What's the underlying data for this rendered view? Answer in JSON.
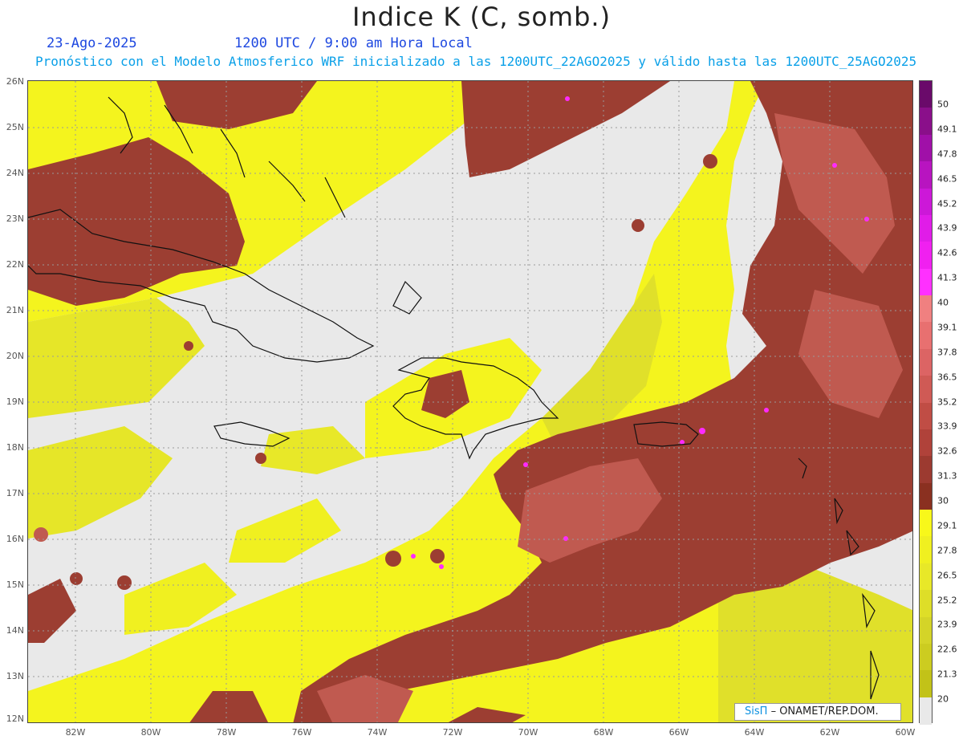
{
  "title": "Indice K (C, somb.)",
  "date": "23-Ago-2025",
  "valid_time": "1200 UTC / 9:00 am Hora Local",
  "subtitle": "Pronóstico con el Modelo Atmosferico WRF inicializado a las 1200UTC_22AGO2025 y válido hasta las  1200UTC_25AGO2025",
  "credit": {
    "logo": "SisΠ",
    "text": "– ONAMET/REP.DOM."
  },
  "lat_labels": [
    "26N",
    "25N",
    "24N",
    "23N",
    "22N",
    "21N",
    "20N",
    "19N",
    "18N",
    "17N",
    "16N",
    "15N",
    "14N",
    "13N",
    "12N"
  ],
  "lon_labels": [
    "82W",
    "80W",
    "78W",
    "76W",
    "74W",
    "72W",
    "70W",
    "68W",
    "66W",
    "64W",
    "62W",
    "60W"
  ],
  "colorbar": {
    "labels": [
      "50",
      "49.1",
      "47.8",
      "46.5",
      "45.2",
      "43.9",
      "42.6",
      "41.3",
      "40",
      "39.1",
      "37.8",
      "36.5",
      "35.2",
      "33.9",
      "32.6",
      "31.3",
      "30",
      "29.1",
      "27.8",
      "26.5",
      "25.2",
      "23.9",
      "22.6",
      "21.3",
      "20"
    ],
    "colors": [
      "#6a0a6a",
      "#8a0f8a",
      "#a010a8",
      "#b814c0",
      "#cc18d8",
      "#e01ce8",
      "#f020f0",
      "#ff30ff",
      "#f08080",
      "#e87070",
      "#dc6464",
      "#cf5a55",
      "#c04d45",
      "#b0423a",
      "#9c3a30",
      "#8a3020",
      "#f8f81a",
      "#f0f020",
      "#e8e828",
      "#dede28",
      "#d4d428",
      "#cccc20",
      "#c2c218",
      "#e9e9e9"
    ],
    "field_colors": {
      "none": "#e9e9e9",
      "low": "#d8d828",
      "mid": "#f4f41e",
      "high": "#9c3e32",
      "higher": "#c05a50",
      "peak": "#ff2aff"
    }
  }
}
